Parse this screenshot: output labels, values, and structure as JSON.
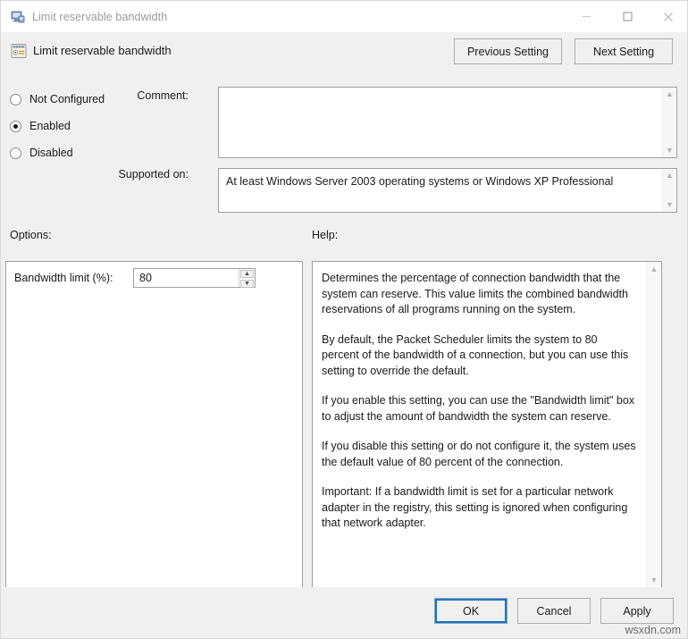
{
  "window": {
    "title": "Limit reservable bandwidth",
    "title_icon": "computer-policy-icon",
    "controls": {
      "minimize": "minimize-icon",
      "maximize": "maximize-icon",
      "close": "close-icon"
    }
  },
  "header": {
    "icon": "policy-setting-icon",
    "title": "Limit reservable bandwidth",
    "previous_label": "Previous Setting",
    "next_label": "Next Setting"
  },
  "state": {
    "options": [
      {
        "label": "Not Configured",
        "selected": false
      },
      {
        "label": "Enabled",
        "selected": true
      },
      {
        "label": "Disabled",
        "selected": false
      }
    ]
  },
  "comment": {
    "label": "Comment:",
    "value": ""
  },
  "supported": {
    "label": "Supported on:",
    "value": "At least Windows Server 2003 operating systems or Windows XP Professional"
  },
  "options_section": {
    "label": "Options:",
    "bandwidth_label": "Bandwidth limit (%):",
    "bandwidth_value": "80",
    "spinner_up": "spin-up-icon",
    "spinner_down": "spin-down-icon"
  },
  "help_section": {
    "label": "Help:",
    "paragraphs": [
      "Determines the percentage of connection bandwidth that the system can reserve. This value limits the combined bandwidth reservations of all programs running on the system.",
      "By default, the Packet Scheduler limits the system to 80 percent of the bandwidth of a connection, but you can use this setting to override the default.",
      "If you enable this setting, you can use the \"Bandwidth limit\" box to adjust the amount of bandwidth the system can reserve.",
      "If you disable this setting or do not configure it, the system uses the default value of 80 percent of the connection.",
      "Important: If a bandwidth limit is set for a particular network adapter in the registry, this setting is ignored when configuring that network adapter."
    ]
  },
  "footer": {
    "ok_label": "OK",
    "cancel_label": "Cancel",
    "apply_label": "Apply"
  },
  "watermark": "wsxdn.com",
  "colors": {
    "accent": "#0078d7",
    "window_bg": "#f0f0f0",
    "field_bg": "#ffffff",
    "border": "#a0a0a0"
  }
}
